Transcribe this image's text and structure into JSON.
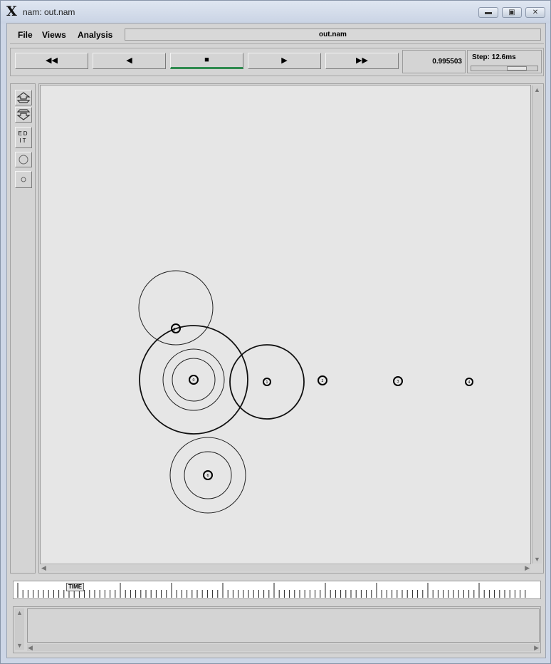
{
  "window": {
    "title": "nam: out.nam"
  },
  "menu": {
    "items": [
      {
        "label": "File"
      },
      {
        "label": "Views"
      },
      {
        "label": "Analysis"
      }
    ]
  },
  "file_title": "out.nam",
  "playback": {
    "buttons": [
      {
        "icon": "rewind-icon",
        "glyph": "◀◀"
      },
      {
        "icon": "step-back-icon",
        "glyph": "◀"
      },
      {
        "icon": "stop-icon",
        "glyph": "■"
      },
      {
        "icon": "play-icon",
        "glyph": "▶"
      },
      {
        "icon": "fast-forward-icon",
        "glyph": "▶▶"
      }
    ],
    "active_button": "stop",
    "time": "0.995503",
    "step_label": "Step: 12.6ms"
  },
  "tools": [
    {
      "icon": "zoom-in-icon"
    },
    {
      "icon": "zoom-out-icon"
    },
    {
      "icon": "edit-icon",
      "label": "ED IT"
    },
    {
      "icon": "large-circle-icon"
    },
    {
      "icon": "small-circle-icon"
    }
  ],
  "nodes": [
    {
      "id": "0"
    },
    {
      "id": "1"
    },
    {
      "id": "2"
    },
    {
      "id": "3"
    },
    {
      "id": "4"
    },
    {
      "id": "5"
    },
    {
      "id": "6"
    }
  ],
  "timeline": {
    "label": "TIME"
  },
  "colors": {
    "canvas_bg": "#e6e6e6",
    "active_indicator": "#2f8a4f",
    "window_frame": "#cdd6e6"
  }
}
